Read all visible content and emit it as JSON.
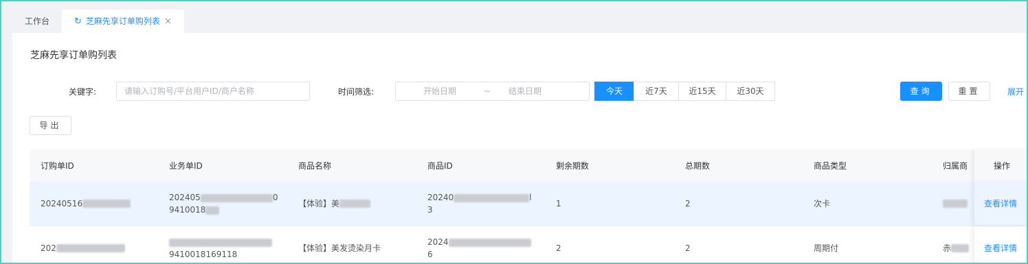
{
  "tabs": [
    {
      "label": "工作台",
      "active": false
    },
    {
      "label": "芝麻先享订单购列表",
      "active": true,
      "closable": true
    }
  ],
  "page_title": "芝麻先享订单购列表",
  "filters": {
    "keyword_label": "关键字:",
    "keyword_placeholder": "请输入订购号/平台用户ID/商户名称",
    "time_label": "时间筛选:",
    "start_placeholder": "开始日期",
    "range_sep": "~",
    "end_placeholder": "结束日期",
    "quick_ranges": [
      "今天",
      "近7天",
      "近15天",
      "近30天"
    ],
    "active_range": "今天",
    "query_button": "查询",
    "reset_button": "重置",
    "expand_link": "展开"
  },
  "export_button": "导出",
  "table": {
    "columns": [
      "订购单ID",
      "业务单ID",
      "商品名称",
      "商品ID",
      "剩余期数",
      "总期数",
      "商品类型",
      "归属商",
      "操作"
    ],
    "rows": [
      {
        "order_id": "20240516",
        "biz_id_line1": "202405",
        "biz_id_line1_tail": "0",
        "biz_id_line2": "9410018",
        "product_name": "【体验】美",
        "product_id_line1": "20240",
        "product_id_line1_tail": "l",
        "product_id_line2": "3",
        "remaining": "1",
        "total": "2",
        "type": "次卡",
        "owner": "",
        "action": "查看详情",
        "highlighted": true
      },
      {
        "order_id": "202",
        "biz_id_line1": "",
        "biz_id_line1_tail": "",
        "biz_id_line2": "9410018169118",
        "product_name": "【体验】美发烫染月卡",
        "product_id_line1": "2024",
        "product_id_line1_tail": "",
        "product_id_line2": "6",
        "remaining": "2",
        "total": "2",
        "type": "周期付",
        "owner": "赤",
        "action": "查看详情",
        "highlighted": false
      }
    ]
  },
  "colors": {
    "accent": "#1890ff",
    "frame_border": "#3fd6c4",
    "row_highlight": "#ecf5ff"
  },
  "icons": {
    "tab_refresh": "refresh-icon",
    "tab_close": "close-icon"
  }
}
